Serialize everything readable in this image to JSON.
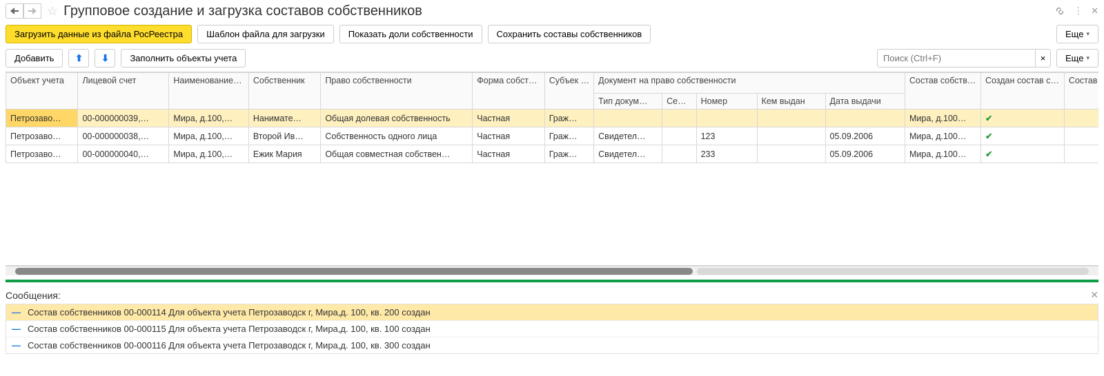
{
  "header": {
    "title": "Групповое создание и загрузка составов собственников"
  },
  "toolbar": {
    "load": "Загрузить данные из файла РосРеестра",
    "template": "Шаблон файла для загрузки",
    "showShares": "Показать доли собственности",
    "saveOwners": "Сохранить составы собственников",
    "more": "Еще"
  },
  "toolbar2": {
    "add": "Добавить",
    "fill": "Заполнить объекты учета",
    "searchPlaceholder": "Поиск (Ctrl+F)",
    "more": "Еще"
  },
  "columns": {
    "object": "Объект учета",
    "account": "Лицевой счет",
    "compName": "Наименование состава",
    "owner": "Собственник",
    "right": "Право собственности",
    "form": "Форма собственнос",
    "subject": "Субъек права",
    "docGroup": "Документ на право собственности",
    "docType": "Тип докум…",
    "series": "Се…",
    "number": "Номер",
    "issuedBy": "Кем выдан",
    "issueDate": "Дата выдачи",
    "ownerComp": "Состав собственнико",
    "compCreated": "Создан состав собственников",
    "compAttached": "Состав привязан к ли"
  },
  "rows": [
    {
      "object": "Петрозаво…",
      "account": "00-000000039,…",
      "name": "Мира, д.100,…",
      "owner": "Нанимате…",
      "right": "Общая долевая собственность",
      "form": "Частная",
      "subject": "Граж…",
      "docType": "",
      "series": "",
      "number": "",
      "issuedBy": "",
      "date": "",
      "comp": "Мира, д.100…",
      "created": true
    },
    {
      "object": "Петрозаво…",
      "account": "00-000000038,…",
      "name": "Мира, д.100,…",
      "owner": "Второй Ив…",
      "right": "Собственность одного лица",
      "form": "Частная",
      "subject": "Граж…",
      "docType": "Свидетел…",
      "series": "",
      "number": "123",
      "issuedBy": "",
      "date": "05.09.2006",
      "comp": "Мира, д.100…",
      "created": true
    },
    {
      "object": "Петрозаво…",
      "account": "00-000000040,…",
      "name": "Мира, д.100,…",
      "owner": "Ежик Мария",
      "right": "Общая совместная собствен…",
      "form": "Частная",
      "subject": "Граж…",
      "docType": "Свидетел…",
      "series": "",
      "number": "233",
      "issuedBy": "",
      "date": "05.09.2006",
      "comp": "Мира, д.100…",
      "created": true
    }
  ],
  "messages": {
    "title": "Сообщения:",
    "items": [
      "Состав собственников 00-000114 Для объекта учета  Петрозаводск г, Мира,д. 100, кв. 200 создан",
      "Состав собственников 00-000115 Для объекта учета  Петрозаводск г, Мира,д. 100, кв. 100 создан",
      "Состав собственников 00-000116 Для объекта учета  Петрозаводск г, Мира,д. 100, кв. 300 создан"
    ]
  }
}
